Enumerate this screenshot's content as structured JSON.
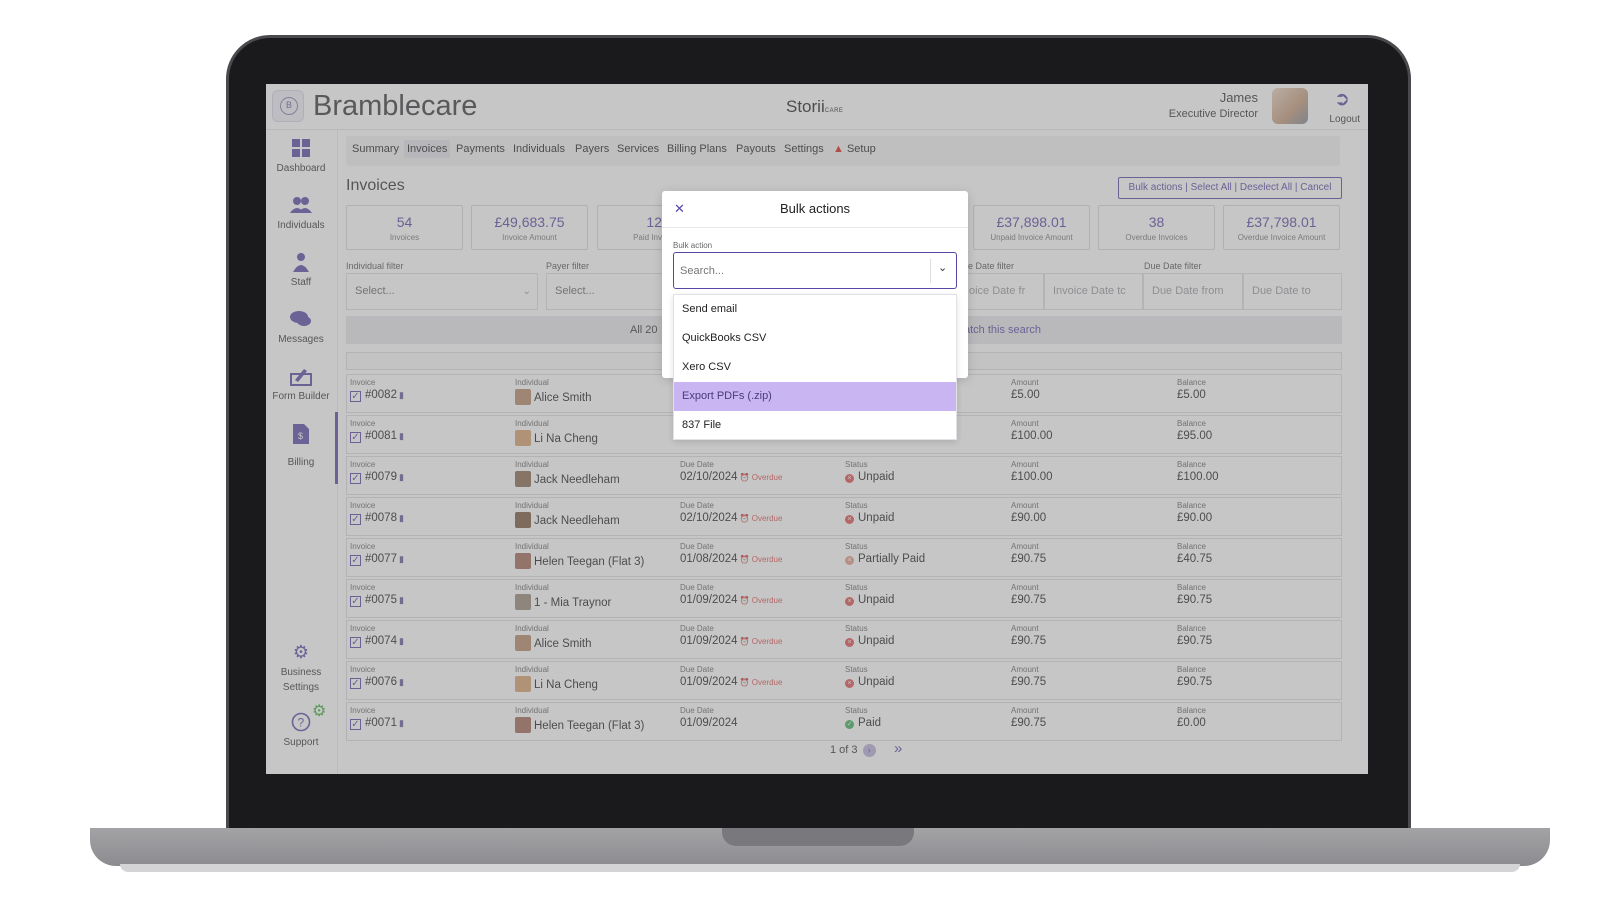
{
  "header": {
    "brand": "Bramblecare",
    "product": "Storii",
    "product_suffix": "CARE",
    "user_name": "James",
    "user_role": "Executive Director",
    "logout_label": "Logout"
  },
  "sidebar": {
    "items": [
      {
        "label": "Dashboard",
        "icon": "dashboard-icon"
      },
      {
        "label": "Individuals",
        "icon": "people-icon"
      },
      {
        "label": "Staff",
        "icon": "staff-icon"
      },
      {
        "label": "Messages",
        "icon": "chat-icon"
      },
      {
        "label": "Form Builder",
        "icon": "form-builder-icon"
      },
      {
        "label": "Billing",
        "icon": "billing-icon"
      },
      {
        "label": "Business",
        "label2": "Settings",
        "icon": "gear-icon"
      },
      {
        "label": "Support",
        "icon": "help-icon"
      }
    ]
  },
  "tabs": [
    "Summary",
    "Invoices",
    "Payments",
    "Individuals",
    "Payers",
    "Services",
    "Billing Plans",
    "Payouts",
    "Settings",
    "Setup"
  ],
  "page": {
    "title": "Invoices",
    "bulk_links": "Bulk actions | Select All | Deselect All | Cancel"
  },
  "stats": [
    {
      "value": "54",
      "label": "Invoices"
    },
    {
      "value": "£49,683.75",
      "label": "Invoice Amount"
    },
    {
      "value": "12",
      "label": "Paid Inv"
    },
    {
      "value": "£37,898.01",
      "label": "Unpaid Invoice Amount"
    },
    {
      "value": "38",
      "label": "Overdue Invoices"
    },
    {
      "value": "£37,798.01",
      "label": "Overdue Invoice Amount"
    }
  ],
  "filters": {
    "individual_label": "Individual filter",
    "individual_value": "Select...",
    "payer_label": "Payer filter",
    "payer_value": "Select...",
    "invoice_date_label": "e Date filter",
    "invoice_date_from": "oice Date fr",
    "invoice_date_to": "Invoice Date tc",
    "due_date_label": "Due Date filter",
    "due_date_from": "Due Date from",
    "due_date_to": "Due Date to"
  },
  "info_bar": {
    "all_text": "All 20",
    "match_text": "atch this search"
  },
  "columns": {
    "invoice": "Invoice",
    "individual": "Individual",
    "due_date": "Due Date",
    "status": "Status",
    "amount": "Amount",
    "balance": "Balance"
  },
  "rows": [
    {
      "invoice": "#0082",
      "individual": "Alice Smith",
      "due_date": "",
      "overdue": "",
      "status": "",
      "status_color": "",
      "amount": "£5.00",
      "balance": "£5.00"
    },
    {
      "invoice": "#0081",
      "individual": "Li Na Cheng",
      "due_date": "",
      "overdue": "",
      "status": "",
      "status_color": "",
      "amount": "£100.00",
      "balance": "£95.00"
    },
    {
      "invoice": "#0079",
      "individual": "Jack Needleham",
      "due_date": "02/10/2024",
      "overdue": "Overdue",
      "status": "Unpaid",
      "status_color": "#e05252",
      "amount": "£100.00",
      "balance": "£100.00"
    },
    {
      "invoice": "#0078",
      "individual": "Jack Needleham",
      "due_date": "02/10/2024",
      "overdue": "Overdue",
      "status": "Unpaid",
      "status_color": "#e05252",
      "amount": "£90.00",
      "balance": "£90.00"
    },
    {
      "invoice": "#0077",
      "individual": "Helen Teegan (Flat 3)",
      "due_date": "01/08/2024",
      "overdue": "Overdue",
      "status": "Partially Paid",
      "status_color": "#e89a8a",
      "amount": "£90.75",
      "balance": "£40.75"
    },
    {
      "invoice": "#0075",
      "individual": "1 - Mia Traynor",
      "due_date": "01/09/2024",
      "overdue": "Overdue",
      "status": "Unpaid",
      "status_color": "#e05252",
      "amount": "£90.75",
      "balance": "£90.75"
    },
    {
      "invoice": "#0074",
      "individual": "Alice Smith",
      "due_date": "01/09/2024",
      "overdue": "Overdue",
      "status": "Unpaid",
      "status_color": "#e05252",
      "amount": "£90.75",
      "balance": "£90.75"
    },
    {
      "invoice": "#0076",
      "individual": "Li Na Cheng",
      "due_date": "01/09/2024",
      "overdue": "Overdue",
      "status": "Unpaid",
      "status_color": "#e05252",
      "amount": "£90.75",
      "balance": "£90.75"
    },
    {
      "invoice": "#0071",
      "individual": "Helen Teegan (Flat 3)",
      "due_date": "01/09/2024",
      "overdue": "",
      "status": "Paid",
      "status_color": "#3fae5a",
      "amount": "£90.75",
      "balance": "£0.00"
    }
  ],
  "pager": {
    "text": "1 of 3"
  },
  "modal": {
    "title": "Bulk actions",
    "field_label": "Bulk action",
    "placeholder": "Search...",
    "options": [
      "Send email",
      "QuickBooks CSV",
      "Xero CSV",
      "Export PDFs (.zip)",
      "837 File"
    ],
    "highlighted_option": "Export PDFs (.zip)"
  },
  "colors": {
    "accent": "#5b46a6",
    "highlight": "#c9b5f2"
  }
}
